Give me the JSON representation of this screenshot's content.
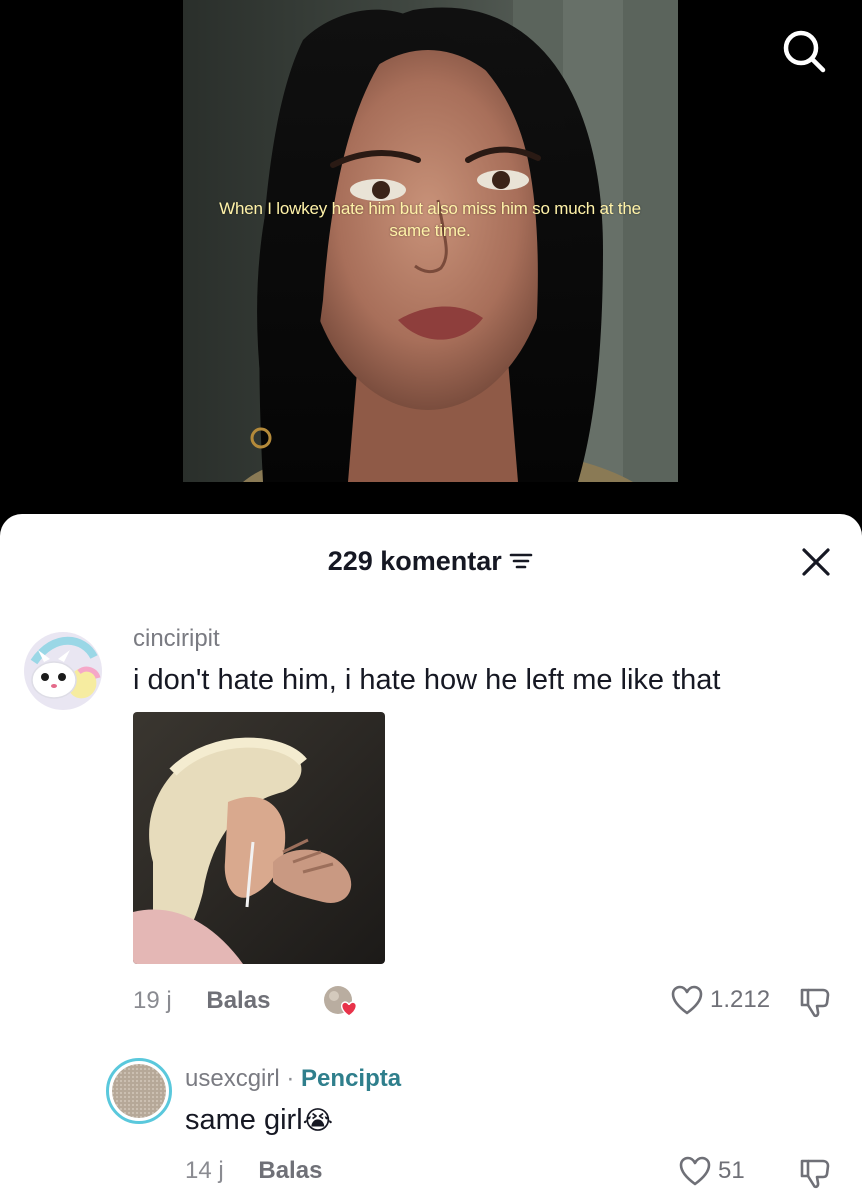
{
  "video": {
    "caption": "When I lowkey hate him but also miss him so much at the same time.",
    "search_icon": "search-icon"
  },
  "sheet": {
    "title": "229 komentar",
    "sort_icon": "sort-icon",
    "close_icon": "close-icon"
  },
  "comments": [
    {
      "username": "cinciripit",
      "text": "i don't hate him, i hate how he left me like that",
      "time": "19 j",
      "reply_label": "Balas",
      "likes": "1.212",
      "has_image": true
    },
    {
      "username": "usexcgirl",
      "separator": "·",
      "creator_label": "Pencipta",
      "text": "same girl",
      "emoji": "😭",
      "time": "14 j",
      "reply_label": "Balas",
      "likes": "51"
    }
  ],
  "colors": {
    "creator_accent": "#2f7f8c",
    "liked_heart": "#e8334a",
    "text_primary": "#161823",
    "text_secondary": "#7a7b82"
  }
}
